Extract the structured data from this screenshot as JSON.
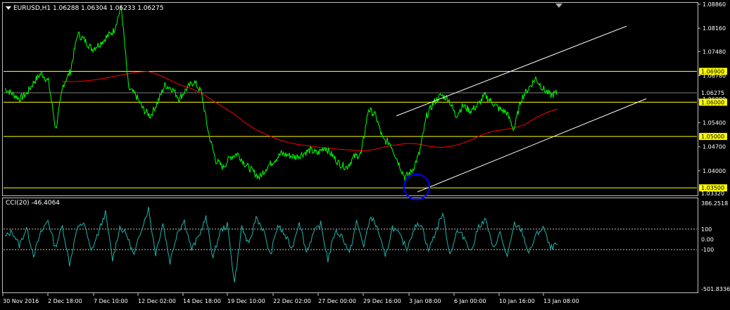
{
  "header": {
    "symbol_line": "EURUSD,H1  1.06288 1.06304 1.06233 1.06275"
  },
  "indicator": {
    "label": "CCI(20) -46.4064"
  },
  "colors": {
    "background": "#000000",
    "price": "#00ff00",
    "moving_average": "#ff0000",
    "levels": "#ffff00",
    "channel": "#ffffff",
    "cci": "#20b2aa",
    "circle": "#0000ff",
    "axis": "#c0c0c0"
  },
  "chart_data": [
    {
      "type": "line",
      "name": "EURUSD H1 price",
      "ylim": [
        1.0332,
        1.0886
      ],
      "y_ticks": [
        "1.08860",
        "1.08160",
        "1.07480",
        "1.06780",
        "1.06090",
        "1.05400",
        "1.04700",
        "1.04000"
      ],
      "x_ticks": [
        "30 Nov 2016",
        "2 Dec 18:00",
        "7 Dec 10:00",
        "12 Dec 02:00",
        "14 Dec 18:00",
        "19 Dec 10:00",
        "22 Dec 02:00",
        "27 Dec 00:00",
        "29 Dec 16:00",
        "3 Jan 08:00",
        "6 Jan 00:00",
        "10 Jan 16:00",
        "13 Jan 08:00"
      ],
      "current_price": "1.06275",
      "levels": [
        {
          "value": 1.069,
          "label": "1.06900"
        },
        {
          "value": 1.06,
          "label": "1.06000"
        },
        {
          "value": 1.05,
          "label": "1.05000"
        },
        {
          "value": 1.035,
          "label": "1.03500"
        }
      ],
      "bottom_price_label": "1.03320",
      "series": [
        {
          "values": [
            1.064,
            1.0625,
            1.061,
            1.0625,
            1.066,
            1.0685,
            1.066,
            1.052,
            1.065,
            1.069,
            1.08,
            1.078,
            1.0755,
            1.077,
            1.079,
            1.081,
            1.088,
            1.064,
            1.062,
            1.058,
            1.056,
            1.06,
            1.065,
            1.064,
            1.061,
            1.064,
            1.066,
            1.063,
            1.051,
            1.043,
            1.041,
            1.044,
            1.045,
            1.042,
            1.04,
            1.038,
            1.041,
            1.043,
            1.045,
            1.0445,
            1.044,
            1.045,
            1.046,
            1.045,
            1.047,
            1.0445,
            1.042,
            1.041,
            1.044,
            1.045,
            1.058,
            1.056,
            1.049,
            1.048,
            1.043,
            1.038,
            1.04,
            1.045,
            1.056,
            1.06,
            1.062,
            1.061,
            1.056,
            1.059,
            1.0575,
            1.059,
            1.062,
            1.06,
            1.058,
            1.057,
            1.052,
            1.061,
            1.064,
            1.067,
            1.064,
            1.062,
            1.06275
          ]
        },
        {
          "name": "MA",
          "values": [
            1.066,
            1.066,
            1.0662,
            1.0665,
            1.067,
            1.0676,
            1.0682,
            1.0688,
            1.069,
            1.068,
            1.0665,
            1.065,
            1.064,
            1.0625,
            1.0605,
            1.0585,
            1.0565,
            1.054,
            1.052,
            1.0505,
            1.0492,
            1.0482,
            1.0476,
            1.0472,
            1.0468,
            1.0465,
            1.0462,
            1.046,
            1.0458,
            1.0462,
            1.047,
            1.0475,
            1.048,
            1.0478,
            1.0472,
            1.0468,
            1.047,
            1.0478,
            1.049,
            1.0505,
            1.0515,
            1.052,
            1.0525,
            1.0535,
            1.0555,
            1.057,
            1.058
          ]
        }
      ]
    },
    {
      "type": "line",
      "name": "CCI(20)",
      "ylim": [
        -501.8336,
        386.2518
      ],
      "y_ticks": [
        "386.2518",
        "100",
        "0.00",
        "-100",
        "-501.8336"
      ],
      "levels": [
        100,
        -100
      ],
      "series": [
        {
          "values": [
            20,
            80,
            -60,
            110,
            -150,
            60,
            190,
            -80,
            130,
            -240,
            90,
            170,
            -120,
            60,
            260,
            -200,
            120,
            40,
            -160,
            100,
            300,
            -140,
            160,
            -220,
            70,
            180,
            -100,
            30,
            210,
            -180,
            80,
            140,
            -420,
            120,
            -60,
            220,
            90,
            -160,
            140,
            40,
            -90,
            180,
            -120,
            60,
            150,
            -200,
            80,
            30,
            -140,
            170,
            -60,
            230,
            90,
            -180,
            120,
            40,
            -90,
            110,
            160,
            -110,
            70,
            260,
            -150,
            80,
            20,
            -120,
            130,
            190,
            -90,
            60,
            -180,
            150,
            90,
            -140,
            40,
            120,
            -90,
            -46
          ]
        }
      ]
    }
  ]
}
